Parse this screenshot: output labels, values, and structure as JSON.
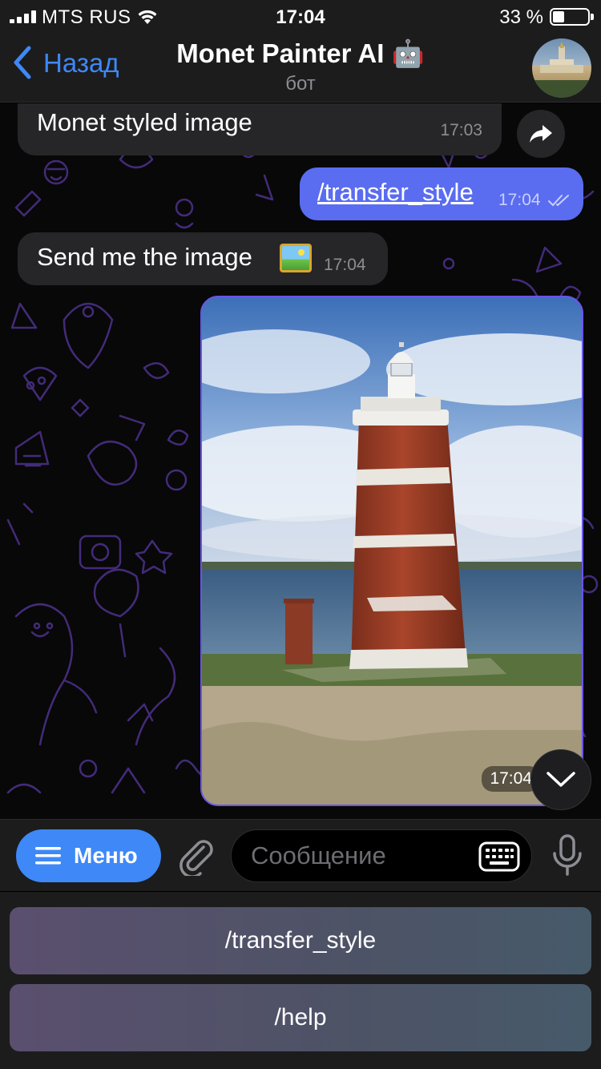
{
  "status_bar": {
    "carrier": "MTS RUS",
    "time": "17:04",
    "battery_percent": "33 %",
    "battery_level": 0.33
  },
  "header": {
    "back_label": "Назад",
    "title": "Monet Painter AI",
    "title_emoji": "🤖",
    "subtitle": "бот"
  },
  "messages": [
    {
      "direction": "incoming",
      "text": "Monet styled image",
      "time": "17:03"
    },
    {
      "direction": "outgoing",
      "text": "/transfer_style",
      "time": "17:04",
      "status": "read"
    },
    {
      "direction": "incoming",
      "text": "Send me the image",
      "emoji": "framed-picture",
      "time": "17:04"
    },
    {
      "direction": "outgoing",
      "type": "photo",
      "photo_subject": "lighthouse",
      "time": "17:04"
    }
  ],
  "input_bar": {
    "menu_label": "Меню",
    "placeholder": "Сообщение"
  },
  "reply_keyboard": {
    "buttons": [
      "/transfer_style",
      "/help"
    ]
  },
  "colors": {
    "accent": "#3e88f7",
    "outgoing_bubble": "#5a6df0",
    "incoming_bubble": "#262628",
    "bar_background": "#1c1c1d",
    "doodle": "#4a2f86"
  }
}
